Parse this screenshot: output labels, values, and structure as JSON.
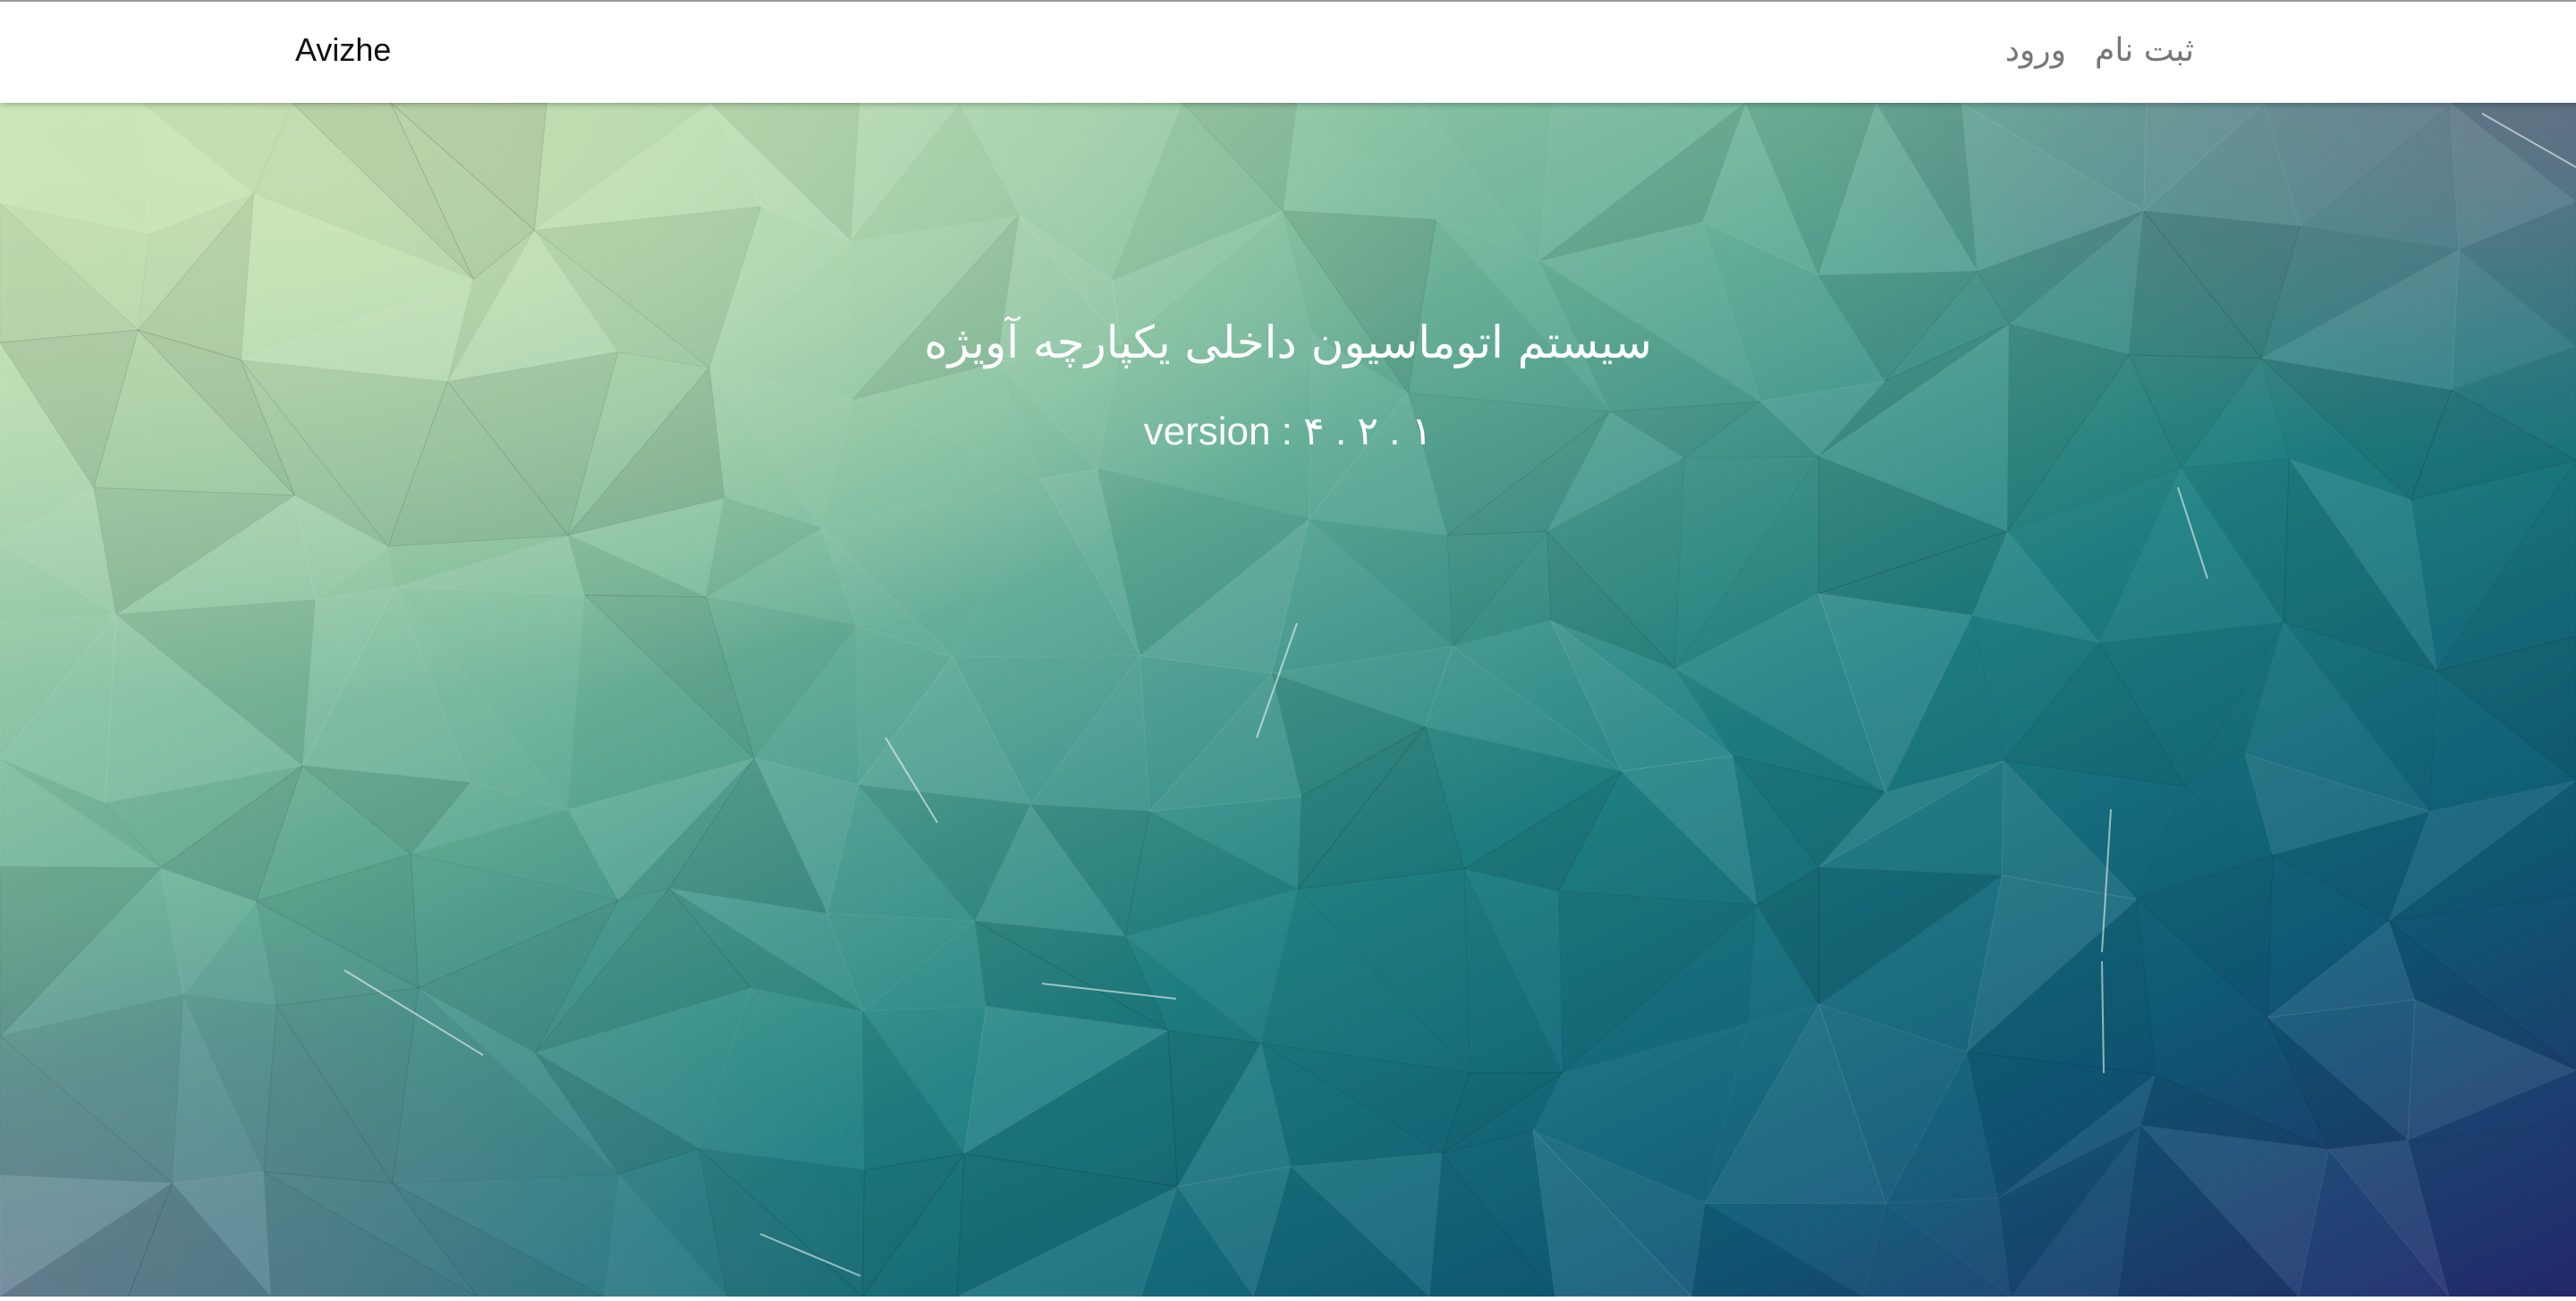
{
  "navbar": {
    "brand": "Avizhe",
    "links": [
      {
        "label": "ورود"
      },
      {
        "label": "ثبت نام"
      }
    ]
  },
  "hero": {
    "title": "سیستم اتوماسیون داخلی یکپارچه آویژه",
    "version": "version : ۴ . ۲ . ۱"
  },
  "colors": {
    "hero_top_left": "#c5e2b4",
    "hero_mid": "#2a8a86",
    "hero_bottom_right": "#262a6e",
    "nav_link": "#777777",
    "brand": "#111111"
  }
}
